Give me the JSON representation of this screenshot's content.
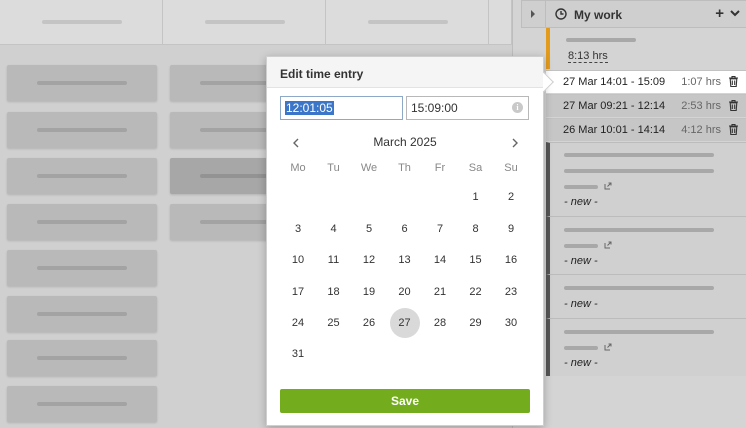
{
  "panel": {
    "title": "My work",
    "running_total": "8:13 hrs",
    "entries": [
      {
        "range": "27 Mar 14:01 - 15:09",
        "duration": "1:07 hrs"
      },
      {
        "range": "27 Mar 09:21 - 12:14",
        "duration": "2:53 hrs"
      },
      {
        "range": "26 Mar 10:01 - 14:14",
        "duration": "4:12 hrs"
      }
    ],
    "tasks": [
      {
        "label": "- new -"
      },
      {
        "label": "- new -"
      },
      {
        "label": "- new -"
      },
      {
        "label": "- new -"
      }
    ]
  },
  "popover": {
    "title": "Edit time entry",
    "start_time": "12:01:05",
    "end_time": "15:09:00",
    "info_icon": "i",
    "month": "March 2025",
    "weekdays": [
      "Mo",
      "Tu",
      "We",
      "Th",
      "Fr",
      "Sa",
      "Su"
    ],
    "days": [
      "1",
      "2",
      "3",
      "4",
      "5",
      "6",
      "7",
      "8",
      "9",
      "10",
      "11",
      "12",
      "13",
      "14",
      "15",
      "16",
      "17",
      "18",
      "19",
      "20",
      "21",
      "22",
      "23",
      "24",
      "25",
      "26",
      "27",
      "28",
      "29",
      "30",
      "31"
    ],
    "today": "27",
    "save_label": "Save"
  },
  "colors": {
    "accent_green": "#73ad1e",
    "running_orange": "#e49b1b",
    "selection_blue": "#3b76c8"
  },
  "icons": [
    "chevron-right-icon",
    "clock-icon",
    "plus-icon",
    "chevron-down-icon",
    "trash-icon",
    "external-link-icon",
    "info-icon",
    "chevron-left-icon"
  ]
}
